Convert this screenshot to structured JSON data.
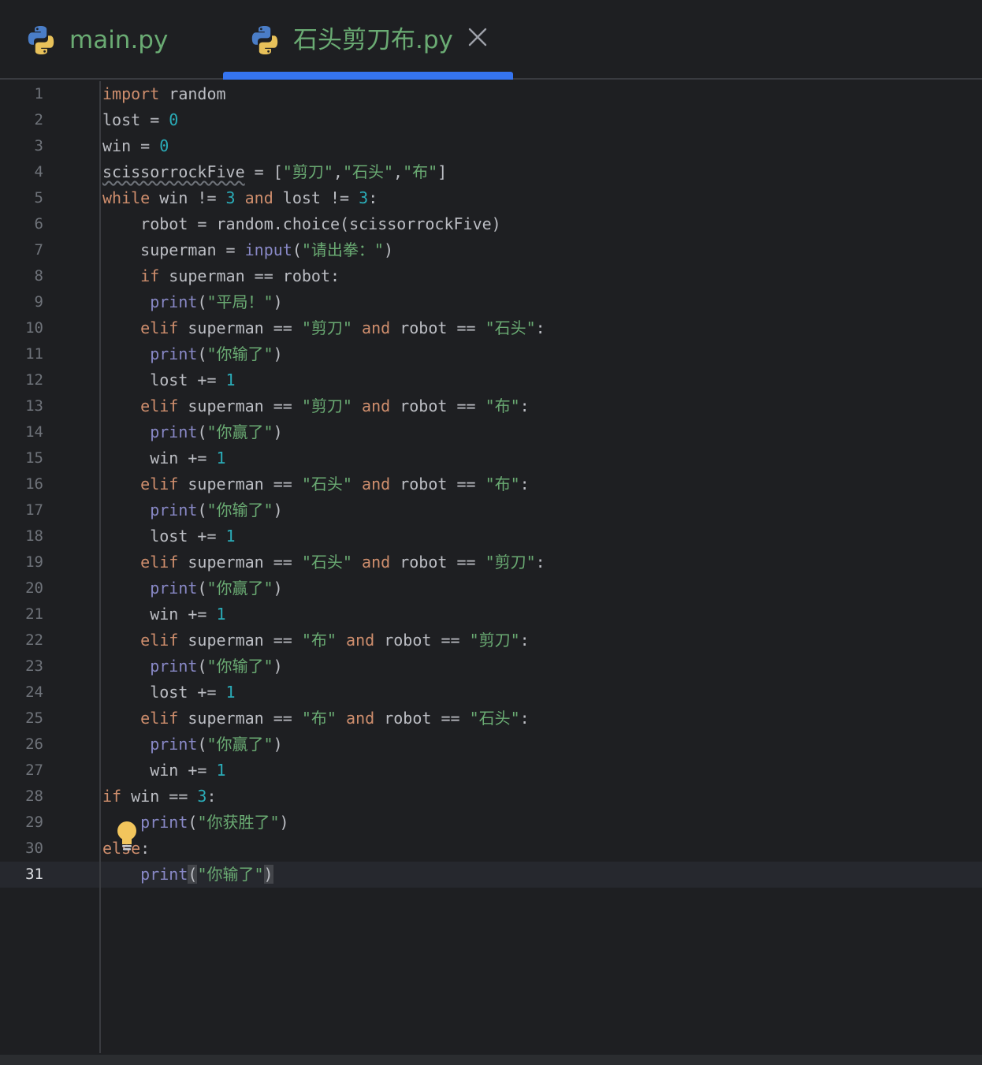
{
  "tabs": [
    {
      "label": "main.py",
      "icon": "python-icon",
      "active": false
    },
    {
      "label": "石头剪刀布.py",
      "icon": "python-icon",
      "active": true,
      "closable": true
    }
  ],
  "colors": {
    "keyword": "#cf8e6d",
    "builtin": "#8888c6",
    "number": "#2aacb8",
    "string": "#6aab73",
    "identifier": "#bcbec4",
    "tab_label": "#6aab73",
    "accent": "#3574f0",
    "bulb": "#f2c55c"
  },
  "editor": {
    "current_line": 31,
    "lines": [
      [
        [
          "kw",
          "import"
        ],
        [
          "id",
          " random"
        ]
      ],
      [
        [
          "id",
          "lost = "
        ],
        [
          "num",
          "0"
        ]
      ],
      [
        [
          "id",
          "win = "
        ],
        [
          "num",
          "0"
        ]
      ],
      [
        [
          "warn",
          "scissorrockFive"
        ],
        [
          "id",
          " = ["
        ],
        [
          "str",
          "\"剪刀\""
        ],
        [
          "id",
          ","
        ],
        [
          "str",
          "\"石头\""
        ],
        [
          "id",
          ","
        ],
        [
          "str",
          "\"布\""
        ],
        [
          "id",
          "]"
        ]
      ],
      [
        [
          "kw",
          "while"
        ],
        [
          "id",
          " win != "
        ],
        [
          "num",
          "3"
        ],
        [
          "id",
          " "
        ],
        [
          "kw",
          "and"
        ],
        [
          "id",
          " lost != "
        ],
        [
          "num",
          "3"
        ],
        [
          "id",
          ":"
        ]
      ],
      [
        [
          "id",
          "    robot = random.choice(scissorrockFive)"
        ]
      ],
      [
        [
          "id",
          "    superman = "
        ],
        [
          "bi",
          "input"
        ],
        [
          "id",
          "("
        ],
        [
          "str",
          "\"请出拳：\""
        ],
        [
          "id",
          ")"
        ]
      ],
      [
        [
          "id",
          "    "
        ],
        [
          "kw",
          "if"
        ],
        [
          "id",
          " superman == robot:"
        ]
      ],
      [
        [
          "id",
          "     "
        ],
        [
          "bi",
          "print"
        ],
        [
          "id",
          "("
        ],
        [
          "str",
          "\"平局！\""
        ],
        [
          "id",
          ")"
        ]
      ],
      [
        [
          "id",
          "    "
        ],
        [
          "kw",
          "elif"
        ],
        [
          "id",
          " superman == "
        ],
        [
          "str",
          "\"剪刀\""
        ],
        [
          "id",
          " "
        ],
        [
          "kw",
          "and"
        ],
        [
          "id",
          " robot == "
        ],
        [
          "str",
          "\"石头\""
        ],
        [
          "id",
          ":"
        ]
      ],
      [
        [
          "id",
          "     "
        ],
        [
          "bi",
          "print"
        ],
        [
          "id",
          "("
        ],
        [
          "str",
          "\"你输了\""
        ],
        [
          "id",
          ")"
        ]
      ],
      [
        [
          "id",
          "     lost += "
        ],
        [
          "num",
          "1"
        ]
      ],
      [
        [
          "id",
          "    "
        ],
        [
          "kw",
          "elif"
        ],
        [
          "id",
          " superman == "
        ],
        [
          "str",
          "\"剪刀\""
        ],
        [
          "id",
          " "
        ],
        [
          "kw",
          "and"
        ],
        [
          "id",
          " robot == "
        ],
        [
          "str",
          "\"布\""
        ],
        [
          "id",
          ":"
        ]
      ],
      [
        [
          "id",
          "     "
        ],
        [
          "bi",
          "print"
        ],
        [
          "id",
          "("
        ],
        [
          "str",
          "\"你赢了\""
        ],
        [
          "id",
          ")"
        ]
      ],
      [
        [
          "id",
          "     win += "
        ],
        [
          "num",
          "1"
        ]
      ],
      [
        [
          "id",
          "    "
        ],
        [
          "kw",
          "elif"
        ],
        [
          "id",
          " superman == "
        ],
        [
          "str",
          "\"石头\""
        ],
        [
          "id",
          " "
        ],
        [
          "kw",
          "and"
        ],
        [
          "id",
          " robot == "
        ],
        [
          "str",
          "\"布\""
        ],
        [
          "id",
          ":"
        ]
      ],
      [
        [
          "id",
          "     "
        ],
        [
          "bi",
          "print"
        ],
        [
          "id",
          "("
        ],
        [
          "str",
          "\"你输了\""
        ],
        [
          "id",
          ")"
        ]
      ],
      [
        [
          "id",
          "     lost += "
        ],
        [
          "num",
          "1"
        ]
      ],
      [
        [
          "id",
          "    "
        ],
        [
          "kw",
          "elif"
        ],
        [
          "id",
          " superman == "
        ],
        [
          "str",
          "\"石头\""
        ],
        [
          "id",
          " "
        ],
        [
          "kw",
          "and"
        ],
        [
          "id",
          " robot == "
        ],
        [
          "str",
          "\"剪刀\""
        ],
        [
          "id",
          ":"
        ]
      ],
      [
        [
          "id",
          "     "
        ],
        [
          "bi",
          "print"
        ],
        [
          "id",
          "("
        ],
        [
          "str",
          "\"你赢了\""
        ],
        [
          "id",
          ")"
        ]
      ],
      [
        [
          "id",
          "     win += "
        ],
        [
          "num",
          "1"
        ]
      ],
      [
        [
          "id",
          "    "
        ],
        [
          "kw",
          "elif"
        ],
        [
          "id",
          " superman == "
        ],
        [
          "str",
          "\"布\""
        ],
        [
          "id",
          " "
        ],
        [
          "kw",
          "and"
        ],
        [
          "id",
          " robot == "
        ],
        [
          "str",
          "\"剪刀\""
        ],
        [
          "id",
          ":"
        ]
      ],
      [
        [
          "id",
          "     "
        ],
        [
          "bi",
          "print"
        ],
        [
          "id",
          "("
        ],
        [
          "str",
          "\"你输了\""
        ],
        [
          "id",
          ")"
        ]
      ],
      [
        [
          "id",
          "     lost += "
        ],
        [
          "num",
          "1"
        ]
      ],
      [
        [
          "id",
          "    "
        ],
        [
          "kw",
          "elif"
        ],
        [
          "id",
          " superman == "
        ],
        [
          "str",
          "\"布\""
        ],
        [
          "id",
          " "
        ],
        [
          "kw",
          "and"
        ],
        [
          "id",
          " robot == "
        ],
        [
          "str",
          "\"石头\""
        ],
        [
          "id",
          ":"
        ]
      ],
      [
        [
          "id",
          "     "
        ],
        [
          "bi",
          "print"
        ],
        [
          "id",
          "("
        ],
        [
          "str",
          "\"你赢了\""
        ],
        [
          "id",
          ")"
        ]
      ],
      [
        [
          "id",
          "     win += "
        ],
        [
          "num",
          "1"
        ]
      ],
      [
        [
          "kw",
          "if"
        ],
        [
          "id",
          " win == "
        ],
        [
          "num",
          "3"
        ],
        [
          "id",
          ":"
        ]
      ],
      [
        [
          "id",
          "    "
        ],
        [
          "bi",
          "print"
        ],
        [
          "id",
          "("
        ],
        [
          "str",
          "\"你获胜了\""
        ],
        [
          "id",
          ")"
        ]
      ],
      [
        [
          "kw",
          "else"
        ],
        [
          "id",
          ":"
        ]
      ],
      [
        [
          "id",
          "    "
        ],
        [
          "bi",
          "print"
        ],
        [
          "hl",
          "("
        ],
        [
          "str",
          "\"你输了\""
        ],
        [
          "hl",
          ")"
        ]
      ]
    ]
  }
}
